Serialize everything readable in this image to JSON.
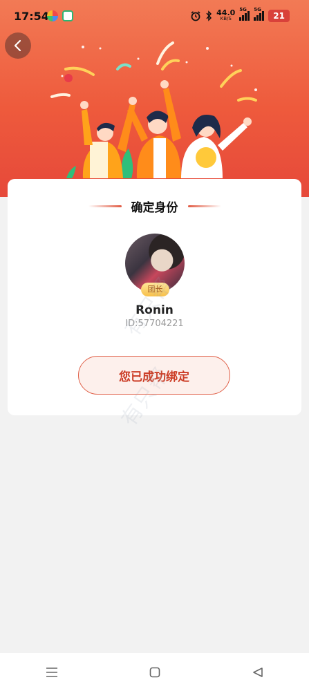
{
  "status_bar": {
    "time": "17:54",
    "net_speed": "44.0",
    "net_unit": "KB/S",
    "sim1": "5G",
    "sim2": "5G",
    "battery": "21"
  },
  "header": {
    "back_icon": "chevron-left-icon"
  },
  "card": {
    "title": "确定身份",
    "avatar_badge": "团长",
    "user_name": "Ronin",
    "user_id": "ID:57704221",
    "status_button_label": "您已成功绑定"
  },
  "watermark": "有只帮",
  "colors": {
    "brand": "#ee5a3c",
    "accent_text": "#cc3d26",
    "badge": "#f7c04a"
  },
  "nav": {
    "menu_icon": "menu-icon",
    "home_icon": "home-square-icon",
    "back_icon": "back-triangle-icon"
  }
}
